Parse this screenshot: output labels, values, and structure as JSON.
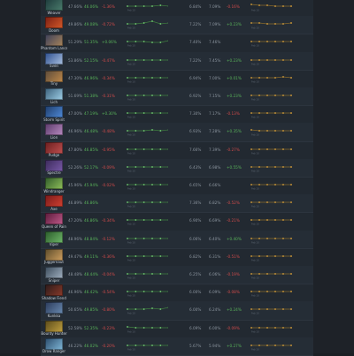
{
  "rows": [
    {
      "hero": "Weaver",
      "wr": "47.66%",
      "wr2": "46.06%",
      "chg": "-1.36%",
      "chg_cls": "neg",
      "pr": "6.84%",
      "pr2": "7.09%",
      "prc": "-0.16%",
      "prc_cls": "neg",
      "col1": "#1d3a3b",
      "col2": "#4b7d6d",
      "spark1": [
        6,
        6,
        6,
        6,
        5,
        6,
        6
      ],
      "spark2": [
        4,
        5,
        5,
        6,
        6,
        6,
        6
      ]
    },
    {
      "hero": "Doom",
      "wr": "49.86%",
      "wr2": "49.08%",
      "chg": "-0.72%",
      "chg_cls": "neg",
      "pr": "7.22%",
      "pr2": "7.09%",
      "prc": "+0.23%",
      "prc_cls": "pos",
      "col1": "#7a1e12",
      "col2": "#d45a2a",
      "spark1": [
        6,
        6,
        5,
        3,
        6,
        5,
        6
      ],
      "spark2": [
        5,
        5,
        6,
        6,
        6,
        5,
        6
      ]
    },
    {
      "hero": "Phantom Lancer",
      "wr": "51.29%",
      "wr2": "51.35%",
      "chg": "+0.06%",
      "chg_cls": "pos",
      "pr": "7.40%",
      "pr2": "7.46%",
      "prc": "",
      "prc_cls": "neu",
      "col1": "#3a3f5a",
      "col2": "#a8845a",
      "spark1": [
        6,
        6,
        6,
        7,
        7,
        5,
        6
      ],
      "spark2": [
        6,
        6,
        6,
        6,
        6,
        6,
        6
      ]
    },
    {
      "hero": "Sven",
      "wr": "53.86%",
      "wr2": "52.15%",
      "chg": "-0.47%",
      "chg_cls": "neg",
      "pr": "7.22%",
      "pr2": "7.45%",
      "prc": "+0.23%",
      "prc_cls": "pos",
      "col1": "#2d4f8f",
      "col2": "#a9c0e0",
      "spark1": [
        6,
        6,
        6,
        6,
        6,
        6,
        6
      ],
      "spark2": [
        6,
        6,
        6,
        6,
        6,
        6,
        6
      ]
    },
    {
      "hero": "Tiny",
      "wr": "47.30%",
      "wr2": "46.96%",
      "chg": "-0.34%",
      "chg_cls": "neg",
      "pr": "6.94%",
      "pr2": "7.00%",
      "prc": "+0.01%",
      "prc_cls": "pos",
      "col1": "#5a4a3a",
      "col2": "#c08a4a",
      "spark1": [
        6,
        6,
        6,
        6,
        6,
        6,
        6
      ],
      "spark2": [
        6,
        6,
        6,
        6,
        5,
        6,
        6
      ]
    },
    {
      "hero": "Lich",
      "wr": "51.69%",
      "wr2": "51.38%",
      "chg": "-0.31%",
      "chg_cls": "neg",
      "pr": "6.92%",
      "pr2": "7.15%",
      "prc": "+0.23%",
      "prc_cls": "pos",
      "col1": "#3a5f7a",
      "col2": "#9fd0e8",
      "spark1": [
        6,
        6,
        6,
        6,
        6,
        6,
        6
      ],
      "spark2": [
        6,
        6,
        6,
        6,
        6,
        6,
        6
      ]
    },
    {
      "hero": "Storm Spirit",
      "wr": "47.00%",
      "wr2": "47.19%",
      "chg": "+0.30%",
      "chg_cls": "pos",
      "pr": "7.30%",
      "pr2": "7.17%",
      "prc": "-0.13%",
      "prc_cls": "neg",
      "col1": "#1e3c6a",
      "col2": "#4f8ad8",
      "spark1": [
        6,
        6,
        6,
        6,
        6,
        6,
        6
      ],
      "spark2": [
        6,
        6,
        6,
        6,
        6,
        6,
        6
      ]
    },
    {
      "hero": "Lion",
      "wr": "46.96%",
      "wr2": "46.48%",
      "chg": "-0.48%",
      "chg_cls": "neg",
      "pr": "6.93%",
      "pr2": "7.28%",
      "prc": "+0.35%",
      "prc_cls": "pos",
      "col1": "#5a3a6a",
      "col2": "#b88ac0",
      "spark1": [
        6,
        6,
        6,
        5,
        6,
        5,
        6
      ],
      "spark2": [
        5,
        6,
        6,
        6,
        6,
        6,
        6
      ]
    },
    {
      "hero": "Pudge",
      "wr": "47.80%",
      "wr2": "46.85%",
      "chg": "-0.95%",
      "chg_cls": "neg",
      "pr": "7.66%",
      "pr2": "7.39%",
      "prc": "-0.27%",
      "prc_cls": "neg",
      "col1": "#6a1e1e",
      "col2": "#c05050",
      "spark1": [
        6,
        6,
        6,
        6,
        6,
        6,
        6
      ],
      "spark2": [
        6,
        6,
        6,
        6,
        6,
        6,
        6
      ]
    },
    {
      "hero": "Spectre",
      "wr": "52.26%",
      "wr2": "52.17%",
      "chg": "-0.09%",
      "chg_cls": "neg",
      "pr": "6.43%",
      "pr2": "6.98%",
      "prc": "+0.55%",
      "prc_cls": "pos",
      "col1": "#3a2a5a",
      "col2": "#7a5aa8",
      "spark1": [
        6,
        6,
        6,
        6,
        6,
        6,
        6
      ],
      "spark2": [
        6,
        6,
        6,
        6,
        6,
        6,
        6
      ]
    },
    {
      "hero": "Windranger",
      "wr": "45.96%",
      "wr2": "45.94%",
      "chg": "-0.02%",
      "chg_cls": "neg",
      "pr": "6.65%",
      "pr2": "6.66%",
      "prc": "",
      "prc_cls": "neu",
      "col1": "#2f5a2a",
      "col2": "#8fbf5a",
      "spark1": [
        6,
        6,
        6,
        6,
        6,
        6,
        6
      ],
      "spark2": [
        6,
        6,
        6,
        6,
        6,
        6,
        6
      ]
    },
    {
      "hero": "Axe",
      "wr": "46.89%",
      "wr2": "46.86%",
      "chg": "",
      "chg_cls": "neu",
      "pr": "7.36%",
      "pr2": "6.82%",
      "prc": "-0.52%",
      "prc_cls": "neg",
      "col1": "#7a1a1a",
      "col2": "#d04030",
      "spark1": [
        6,
        6,
        6,
        6,
        6,
        6,
        6
      ],
      "spark2": [
        6,
        6,
        6,
        6,
        6,
        6,
        6
      ]
    },
    {
      "hero": "Queen of Pain",
      "wr": "47.20%",
      "wr2": "46.86%",
      "chg": "-0.34%",
      "chg_cls": "neg",
      "pr": "6.90%",
      "pr2": "6.69%",
      "prc": "-0.21%",
      "prc_cls": "neg",
      "col1": "#5a1a3a",
      "col2": "#c05a8a",
      "spark1": [
        6,
        6,
        6,
        6,
        6,
        6,
        6
      ],
      "spark2": [
        6,
        6,
        6,
        6,
        6,
        6,
        6
      ]
    },
    {
      "hero": "Viper",
      "wr": "48.96%",
      "wr2": "48.84%",
      "chg": "-0.12%",
      "chg_cls": "neg",
      "pr": "6.06%",
      "pr2": "6.40%",
      "prc": "+0.40%",
      "prc_cls": "pos",
      "col1": "#2a5a2a",
      "col2": "#6fb86a",
      "spark1": [
        6,
        6,
        6,
        6,
        6,
        6,
        6
      ],
      "spark2": [
        6,
        6,
        6,
        6,
        6,
        6,
        6
      ]
    },
    {
      "hero": "Juggernaut",
      "wr": "49.47%",
      "wr2": "49.11%",
      "chg": "-0.36%",
      "chg_cls": "neg",
      "pr": "6.82%",
      "pr2": "6.31%",
      "prc": "-0.51%",
      "prc_cls": "neg",
      "col1": "#5a4a2a",
      "col2": "#d0a060",
      "spark1": [
        6,
        6,
        6,
        6,
        6,
        6,
        6
      ],
      "spark2": [
        6,
        6,
        6,
        6,
        6,
        6,
        6
      ]
    },
    {
      "hero": "Sniper",
      "wr": "48.48%",
      "wr2": "48.44%",
      "chg": "-0.04%",
      "chg_cls": "neg",
      "pr": "6.25%",
      "pr2": "6.06%",
      "prc": "-0.19%",
      "prc_cls": "neg",
      "col1": "#3a4a5a",
      "col2": "#a0b0c0",
      "spark1": [
        6,
        6,
        6,
        6,
        6,
        6,
        6
      ],
      "spark2": [
        6,
        6,
        6,
        6,
        6,
        6,
        6
      ]
    },
    {
      "hero": "Shadow Fiend",
      "wr": "46.96%",
      "wr2": "46.42%",
      "chg": "-0.54%",
      "chg_cls": "neg",
      "pr": "6.00%",
      "pr2": "6.09%",
      "prc": "-0.08%",
      "prc_cls": "neg",
      "col1": "#2a1a1a",
      "col2": "#8a3a2a",
      "spark1": [
        6,
        6,
        6,
        6,
        6,
        6,
        6
      ],
      "spark2": [
        6,
        6,
        6,
        6,
        6,
        6,
        6
      ]
    },
    {
      "hero": "Kunkka",
      "wr": "50.65%",
      "wr2": "49.85%",
      "chg": "-0.80%",
      "chg_cls": "neg",
      "pr": "6.00%",
      "pr2": "6.24%",
      "prc": "+0.24%",
      "prc_cls": "pos",
      "col1": "#2a3a5a",
      "col2": "#6a8ab0",
      "spark1": [
        6,
        6,
        6,
        5,
        6,
        4,
        6
      ],
      "spark2": [
        6,
        6,
        6,
        6,
        6,
        6,
        6
      ]
    },
    {
      "hero": "Bounty Hunter",
      "wr": "52.58%",
      "wr2": "52.35%",
      "chg": "-0.23%",
      "chg_cls": "neg",
      "pr": "6.09%",
      "pr2": "6.00%",
      "prc": "-0.09%",
      "prc_cls": "neg",
      "col1": "#5a4a1a",
      "col2": "#c0a040",
      "spark1": [
        5,
        6,
        6,
        6,
        6,
        6,
        6
      ],
      "spark2": [
        6,
        6,
        6,
        6,
        6,
        6,
        6
      ]
    },
    {
      "hero": "Drow Ranger",
      "wr": "46.22%",
      "wr2": "46.02%",
      "chg": "-0.20%",
      "chg_cls": "neg",
      "pr": "5.67%",
      "pr2": "5.94%",
      "prc": "+0.27%",
      "prc_cls": "pos",
      "col1": "#2a4a6a",
      "col2": "#80b8d8",
      "spark1": [
        6,
        6,
        6,
        6,
        6,
        6,
        6
      ],
      "spark2": [
        6,
        6,
        6,
        6,
        6,
        6,
        6
      ]
    }
  ],
  "tick_labels": [
    "Feb",
    "10",
    "Mar"
  ]
}
